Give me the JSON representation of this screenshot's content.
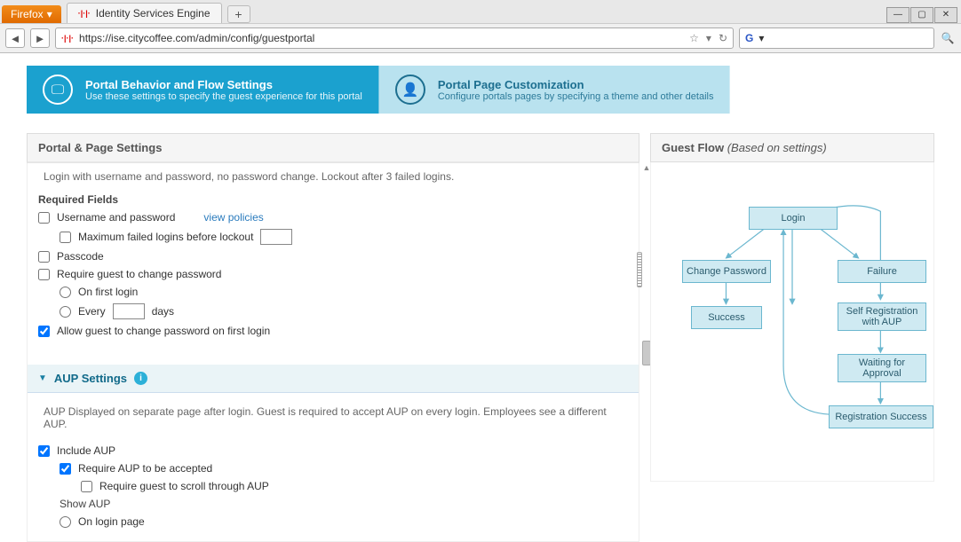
{
  "browser": {
    "firefox_menu": "Firefox",
    "tab_title": "Identity Services Engine",
    "url": "https://ise.citycoffee.com/admin/config/guestportal",
    "new_tab": "+"
  },
  "tabs": {
    "active": {
      "title": "Portal Behavior and Flow Settings",
      "desc": "Use these settings to specify the guest experience for this portal"
    },
    "inactive": {
      "title": "Portal Page Customization",
      "desc": "Configure portals pages by specifying a theme and other details"
    }
  },
  "left_header": "Portal & Page Settings",
  "login_section": {
    "summary": "Login with username and password, no password change. Lockout after 3 failed logins.",
    "required_label": "Required Fields",
    "user_pass": "Username and password",
    "view_policies": "view policies",
    "max_failed": "Maximum failed logins before lockout",
    "passcode": "Passcode",
    "require_change": "Require guest to change password",
    "first_login": "On first login",
    "every": "Every",
    "days": "days",
    "allow_change": "Allow guest to change password on first login"
  },
  "aup_section": {
    "header": "AUP Settings",
    "summary": "AUP Displayed on separate page after login. Guest is required to accept AUP on every login. Employees see a different AUP.",
    "include": "Include AUP",
    "require_accept": "Require AUP to be accepted",
    "require_scroll": "Require guest to scroll through AUP",
    "show_aup": "Show AUP",
    "on_login": "On login page"
  },
  "flow": {
    "header": "Guest Flow",
    "sub": "(Based on settings)",
    "nodes": {
      "login": "Login",
      "change": "Change Password",
      "failure": "Failure",
      "success": "Success",
      "selfreg": "Self Registration with AUP",
      "waiting": "Waiting for Approval",
      "regsucc": "Registration Success"
    }
  }
}
